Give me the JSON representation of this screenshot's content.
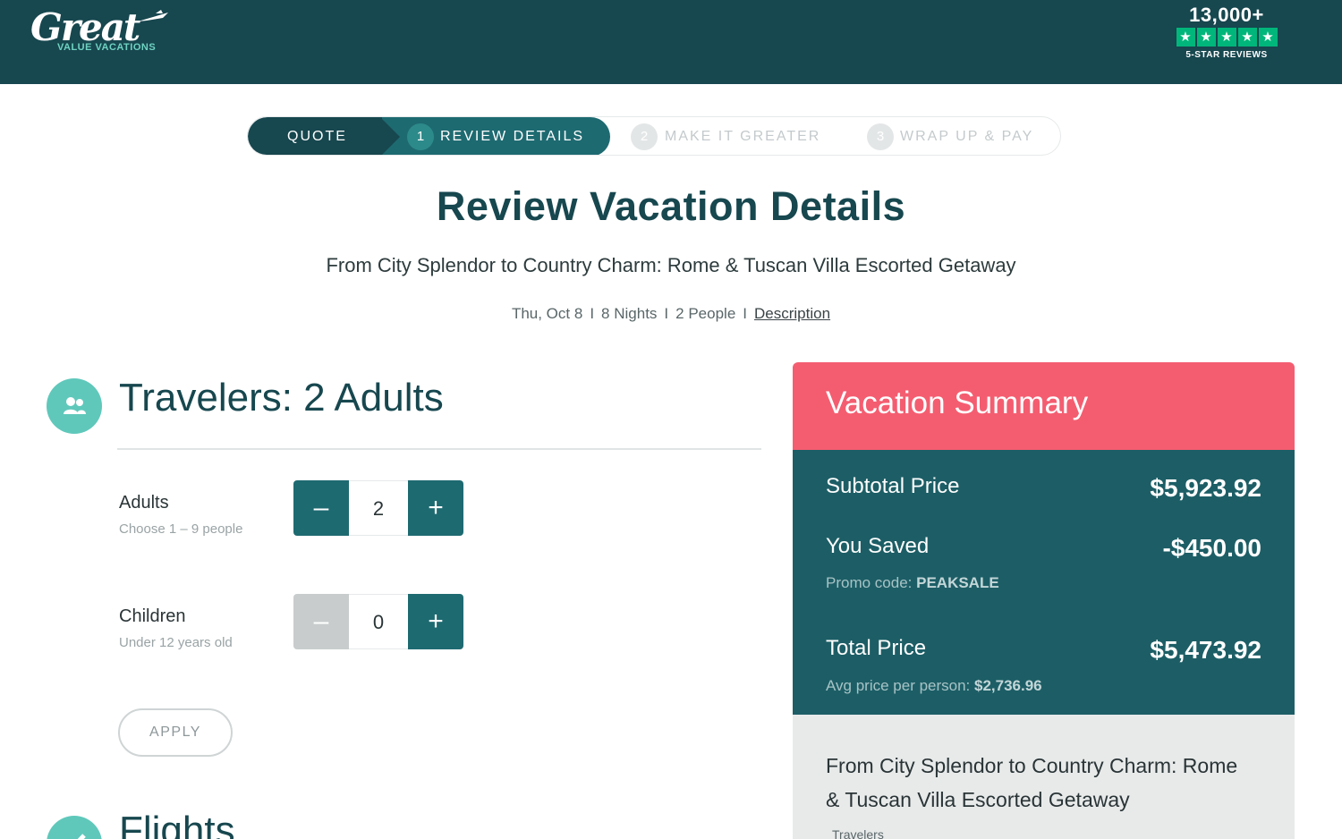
{
  "brand": {
    "logo_script": "Great",
    "logo_sub": "VALUE VACATIONS",
    "reviews_count": "13,000+",
    "reviews_label": "5-STAR REVIEWS",
    "star_glyph": "★"
  },
  "stepper": {
    "steps": [
      {
        "label": "QUOTE",
        "num": ""
      },
      {
        "label": "REVIEW DETAILS",
        "num": "1"
      },
      {
        "label": "MAKE IT GREATER",
        "num": "2"
      },
      {
        "label": "WRAP UP & PAY",
        "num": "3"
      }
    ],
    "active_index": 1
  },
  "header": {
    "title": "Review Vacation Details",
    "trip_name": "From City Splendor to Country Charm: Rome & Tuscan Villa Escorted Getaway",
    "date": "Thu, Oct 8",
    "nights": "8 Nights",
    "people": "2 People",
    "separator": "I",
    "description_link": "Description"
  },
  "travelers": {
    "title": "Travelers: 2 Adults",
    "adults": {
      "label": "Adults",
      "sub": "Choose 1 – 9 people",
      "value": "2",
      "minus": "–",
      "plus": "+"
    },
    "children": {
      "label": "Children",
      "sub": "Under 12 years old",
      "value": "0",
      "minus": "–",
      "plus": "+"
    },
    "apply_label": "APPLY"
  },
  "flights": {
    "title": "Flights"
  },
  "summary": {
    "title": "Vacation Summary",
    "subtotal_label": "Subtotal Price",
    "subtotal_value": "$5,923.92",
    "saved_label": "You Saved",
    "saved_value": "-$450.00",
    "promo_prefix": "Promo code: ",
    "promo_code": "PEAKSALE",
    "total_label": "Total Price",
    "total_value": "$5,473.92",
    "avg_prefix": "Avg price per person: ",
    "avg_value": "$2,736.96",
    "trip_name": "From City Splendor to Country Charm: Rome & Tuscan Villa Escorted Getaway",
    "travelers_label": "Travelers"
  },
  "colors": {
    "header_bg": "#17474f",
    "accent_teal": "#1e6a71",
    "summary_red": "#f45d70",
    "icon_mint": "#5fc8bb",
    "trustpilot_green": "#00b67a"
  },
  "icons": [
    "plane-icon",
    "travelers-icon",
    "check-icon",
    "star-icon"
  ]
}
